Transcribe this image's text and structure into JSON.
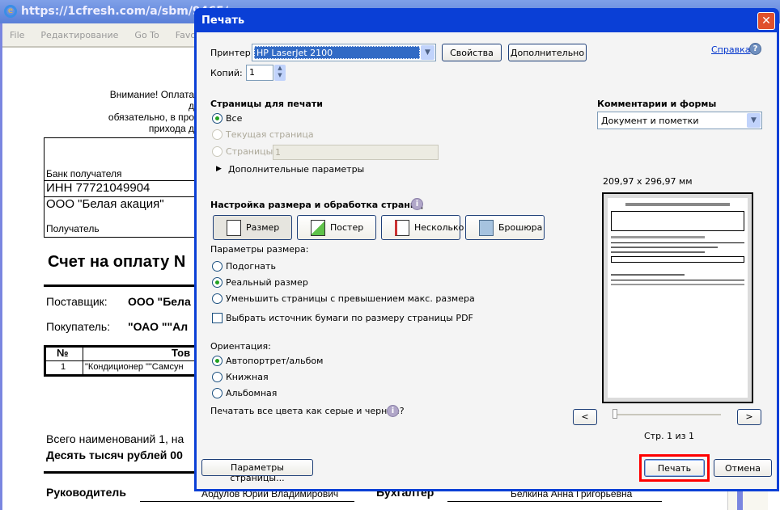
{
  "browser": {
    "title": "https://1cfresh.com/a/sbm/9465/r",
    "menu": [
      "File",
      "Редактирование",
      "Go To",
      "Favorites"
    ]
  },
  "document": {
    "notice": [
      "Внимание! Оплата д",
      "обязательно, в про",
      "прихода д"
    ],
    "bank_label": "Банк получателя",
    "inn": "ИНН    77721049904",
    "recipient_org": "ООО \"Белая акация\"",
    "recipient_label": "Получатель",
    "invoice_title": "Счет на оплату N",
    "supplier_label": "Поставщик:",
    "supplier_value": "ООО \"Бела",
    "buyer_label": "Покупатель:",
    "buyer_value": "\"ОАО \"\"Ал",
    "table_headers": [
      "№",
      "Тов"
    ],
    "table_rows": [
      [
        "1",
        "\"Кондиционер \"\"Самсун"
      ]
    ],
    "total_line": "Всего наименований 1, на",
    "total_words": "Десять тысяч рублей 00",
    "director_label": "Руководитель",
    "director_name": "Абдулов Юрий Владимирович",
    "accountant_label": "Бухгалтер",
    "accountant_name": "Белкина Анна Григорьевна"
  },
  "dialog": {
    "title": "Печать",
    "close": "✕",
    "printer_label": "Принтер:",
    "printer_value": "HP LaserJet 2100",
    "properties": "Свойства",
    "advanced": "Дополнительно",
    "help": "Справка",
    "copies_label": "Копий:",
    "copies_value": "1",
    "pages_heading": "Страницы для печати",
    "pages_options": [
      {
        "label": "Все",
        "selected": true,
        "enabled": true
      },
      {
        "label": "Текущая страница",
        "selected": false,
        "enabled": false
      },
      {
        "label": "Страницы",
        "selected": false,
        "enabled": false
      }
    ],
    "pages_range": "1",
    "more_options": "Дополнительные параметры",
    "comments_heading": "Комментарии и формы",
    "comments_value": "Документ и пометки",
    "sizing_heading": "Настройка размера и обработка страниц",
    "sizing_tools": [
      {
        "label": "Размер",
        "active": true
      },
      {
        "label": "Постер"
      },
      {
        "label": "Несколько"
      },
      {
        "label": "Брошюра"
      }
    ],
    "size_params_label": "Параметры размера:",
    "size_options": [
      {
        "label": "Подогнать",
        "selected": false
      },
      {
        "label": "Реальный размер",
        "selected": true
      },
      {
        "label": "Уменьшить страницы с превышением макс. размера",
        "selected": false
      }
    ],
    "paper_source": "Выбрать источник бумаги по размеру страницы PDF",
    "paper_source_checked": false,
    "orientation_label": "Ориентация:",
    "orientation_options": [
      {
        "label": "Автопортрет/альбом",
        "selected": true
      },
      {
        "label": "Книжная",
        "selected": false
      },
      {
        "label": "Альбомная",
        "selected": false
      }
    ],
    "grayscale": "Печатать все цвета как серые и черные?",
    "preview_size": "209,97 x 296,97 мм",
    "prev": "<",
    "next": ">",
    "page_indicator": "Стр. 1 из 1",
    "page_setup": "Параметры страницы...",
    "print": "Печать",
    "cancel": "Отмена",
    "highlight_color": "#ff0000",
    "title_bar_color": "#0a3fd6"
  }
}
